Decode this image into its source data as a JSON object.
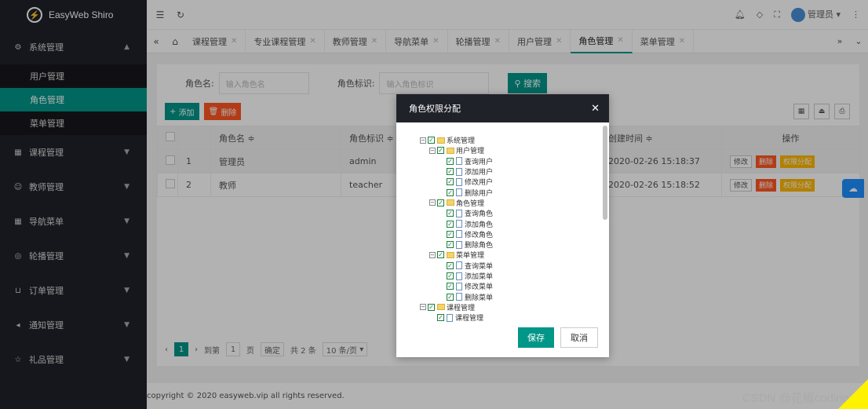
{
  "brand": {
    "title": "EasyWeb Shiro"
  },
  "sidebar": {
    "groups": [
      {
        "label": "系统管理",
        "expanded": true
      },
      {
        "label": "课程管理"
      },
      {
        "label": "教师管理"
      },
      {
        "label": "导航菜单"
      },
      {
        "label": "轮播管理"
      },
      {
        "label": "订单管理"
      },
      {
        "label": "通知管理"
      },
      {
        "label": "礼品管理"
      }
    ],
    "sub_items": [
      "用户管理",
      "角色管理",
      "菜单管理"
    ]
  },
  "topbar": {
    "user": "管理员"
  },
  "tabs": [
    "课程管理",
    "专业课程管理",
    "教师管理",
    "导航菜单",
    "轮播管理",
    "用户管理",
    "角色管理",
    "菜单管理"
  ],
  "search": {
    "role_name_label": "角色名:",
    "role_name_placeholder": "输入角色名",
    "role_key_label": "角色标识:",
    "role_key_placeholder": "输入角色标识",
    "search_button": "搜索"
  },
  "toolbar": {
    "add": "添加",
    "delete": "删除"
  },
  "table": {
    "headers": [
      "",
      "",
      "角色名 ≑",
      "角色标识 ≑",
      "创建时间 ≑",
      "操作"
    ],
    "rows": [
      {
        "index": "1",
        "name": "管理员",
        "key": "admin",
        "created": "2020-02-26 15:18:37"
      },
      {
        "index": "2",
        "name": "教师",
        "key": "teacher",
        "created": "2020-02-26 15:18:52"
      }
    ],
    "actions": {
      "edit": "修改",
      "delete": "删除",
      "perm": "权限分配"
    }
  },
  "pager": {
    "current": "1",
    "goto_label": "到第",
    "page_input": "1",
    "page_unit": "页",
    "confirm": "确定",
    "total": "共 2 条",
    "per_page": "10 条/页"
  },
  "footer": {
    "copyright": "copyright © 2020 easyweb.vip all rights reserved."
  },
  "watermark": "CSDN @花椒coding",
  "dialog": {
    "title": "角色权限分配",
    "save": "保存",
    "cancel": "取消",
    "tree": [
      {
        "level": 0,
        "label": "系统管理",
        "folder": true
      },
      {
        "level": 1,
        "label": "用户管理",
        "folder": true
      },
      {
        "level": 2,
        "label": "查询用户"
      },
      {
        "level": 2,
        "label": "添加用户"
      },
      {
        "level": 2,
        "label": "修改用户"
      },
      {
        "level": 2,
        "label": "删除用户"
      },
      {
        "level": 1,
        "label": "角色管理",
        "folder": true
      },
      {
        "level": 2,
        "label": "查询角色"
      },
      {
        "level": 2,
        "label": "添加角色"
      },
      {
        "level": 2,
        "label": "修改角色"
      },
      {
        "level": 2,
        "label": "删除角色"
      },
      {
        "level": 1,
        "label": "菜单管理",
        "folder": true
      },
      {
        "level": 2,
        "label": "查询菜单"
      },
      {
        "level": 2,
        "label": "添加菜单"
      },
      {
        "level": 2,
        "label": "修改菜单"
      },
      {
        "level": 2,
        "label": "删除菜单"
      },
      {
        "level": 0,
        "label": "课程管理",
        "folder": true
      },
      {
        "level": 1,
        "label": "课程管理",
        "folder": false
      }
    ]
  }
}
